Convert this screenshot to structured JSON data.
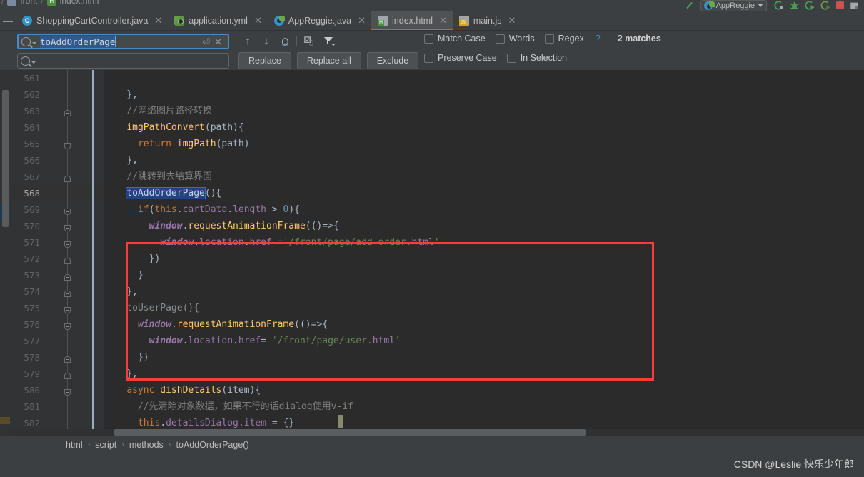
{
  "window": {
    "top_breadcrumb": {
      "folder": "front",
      "file": "index.html",
      "sep": "/"
    },
    "run_config": {
      "label": "AppReggie",
      "icons": [
        "run-icon",
        "debug-icon",
        "run-with-coverage-icon",
        "profile-icon",
        "stop-icon",
        "hide-icon"
      ]
    }
  },
  "tabs": [
    {
      "label": "ShoppingCartController.java",
      "icon": "java-class-icon",
      "active": false,
      "closable": true
    },
    {
      "label": "application.yml",
      "icon": "yaml-file-icon",
      "active": false,
      "closable": true
    },
    {
      "label": "AppReggie.java",
      "icon": "spring-boot-class-icon",
      "active": false,
      "closable": true
    },
    {
      "label": "index.html",
      "icon": "html-file-icon",
      "active": true,
      "closable": true
    },
    {
      "label": "main.js",
      "icon": "javascript-file-icon",
      "active": true,
      "closable": true
    }
  ],
  "find": {
    "search_value": "toAddOrderPage",
    "search_placeholder": "",
    "replace_value": "",
    "replace_placeholder": "",
    "nav_icons": [
      "find-previous-icon",
      "find-next-icon",
      "select-all-occurrences-icon",
      "add-selection-icon",
      "filter-icon"
    ],
    "buttons": {
      "replace": "Replace",
      "replace_all": "Replace all",
      "exclude": "Exclude"
    },
    "options_row1": [
      {
        "label": "Match Case",
        "checked": false
      },
      {
        "label": "Words",
        "checked": false
      },
      {
        "label": "Regex",
        "checked": false
      }
    ],
    "options_row2": [
      {
        "label": "Preserve Case",
        "checked": false
      },
      {
        "label": "In Selection",
        "checked": false
      }
    ],
    "help_glyph": "?",
    "match_count": "2 matches"
  },
  "editor": {
    "file": "index.html",
    "first_line": 561,
    "current_line": 568,
    "selected_token": "toAddOrderPage",
    "highlight_box": {
      "color": "#fa3c3c",
      "from_line": 567,
      "to_line": 574
    },
    "lines": [
      {
        "n": 561,
        "text": ""
      },
      {
        "n": 562,
        "text": "    },"
      },
      {
        "n": 563,
        "text": "    //网络图片路径转换"
      },
      {
        "n": 564,
        "text": "    imgPathConvert(path){"
      },
      {
        "n": 565,
        "text": "      return imgPath(path)"
      },
      {
        "n": 566,
        "text": "    },"
      },
      {
        "n": 567,
        "text": "    //跳转到去结算界面"
      },
      {
        "n": 568,
        "text": "    toAddOrderPage(){"
      },
      {
        "n": 569,
        "text": "      if(this.cartData.length > 0){"
      },
      {
        "n": 570,
        "text": "        window.requestAnimationFrame(()=>{"
      },
      {
        "n": 571,
        "text": "          window.location.href ='/front/page/add-order.html'"
      },
      {
        "n": 572,
        "text": "        })"
      },
      {
        "n": 573,
        "text": "      }"
      },
      {
        "n": 574,
        "text": "    },"
      },
      {
        "n": 575,
        "text": "    toUserPage(){"
      },
      {
        "n": 576,
        "text": "      window.requestAnimationFrame(()=>{"
      },
      {
        "n": 577,
        "text": "        window.location.href= '/front/page/user.html'"
      },
      {
        "n": 578,
        "text": "      })"
      },
      {
        "n": 579,
        "text": "    },"
      },
      {
        "n": 580,
        "text": "    async dishDetails(item){"
      },
      {
        "n": 581,
        "text": "      //先清除对象数据，如果不行的话dialog使用v-if"
      },
      {
        "n": 582,
        "text": "      this.detailsDialog.item = {}"
      }
    ]
  },
  "breadcrumb": {
    "items": [
      "html",
      "script",
      "methods",
      "toAddOrderPage()"
    ],
    "separator": "›"
  },
  "status": {
    "watermark": "CSDN @Leslie 快乐少年郎"
  },
  "colors": {
    "accent": "#4a88c7",
    "highlight_box": "#fa3c3c",
    "selection": "#214283",
    "editor_bg": "#2b2b2b",
    "panel_bg": "#3c3f41"
  }
}
